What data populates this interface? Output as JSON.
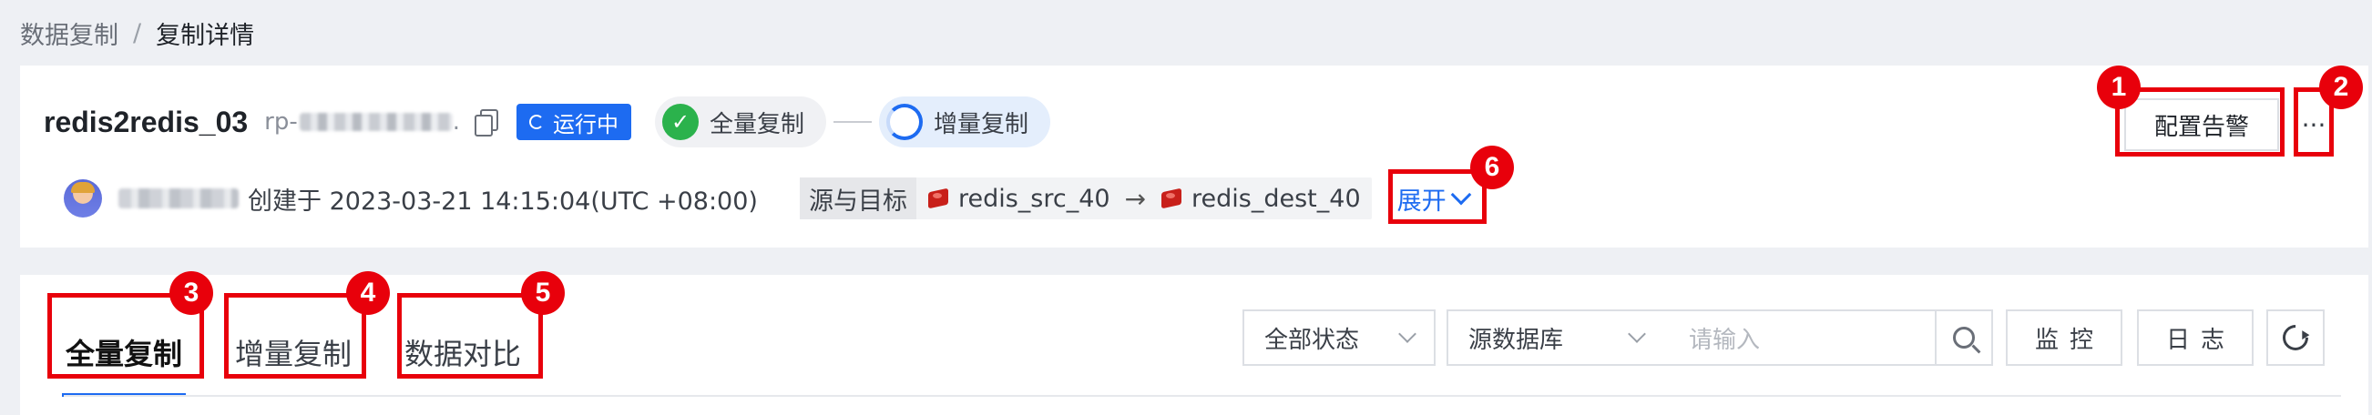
{
  "breadcrumb": {
    "parent": "数据复制",
    "separator": "/",
    "current": "复制详情"
  },
  "task": {
    "name": "redis2redis_03",
    "id_prefix": "rp-",
    "id_suffix": ".",
    "status": "运行中",
    "steps": [
      {
        "label": "全量复制",
        "state": "done"
      },
      {
        "label": "增量复制",
        "state": "running"
      }
    ]
  },
  "meta": {
    "created_text": "创建于 2023-03-21 14:15:04(UTC +08:00)",
    "route_label": "源与目标",
    "source": "redis_src_40",
    "arrow": "→",
    "target": "redis_dest_40",
    "expand_label": "展开"
  },
  "actions": {
    "alert_button": "配置告警",
    "more_button": "···"
  },
  "tabs": [
    {
      "label": "全量复制",
      "active": true
    },
    {
      "label": "增量复制",
      "active": false
    },
    {
      "label": "数据对比",
      "active": false
    }
  ],
  "filters": {
    "status_select": "全部状态",
    "db_select": "源数据库",
    "search_placeholder": "请输入",
    "monitor_button": "监控",
    "log_button": "日志"
  },
  "annotations": [
    "1",
    "2",
    "3",
    "4",
    "5",
    "6"
  ],
  "colors": {
    "primary": "#1d6bf1",
    "success": "#2bb24c",
    "highlight": "#e8000b",
    "redis": "#c8201a"
  },
  "icons": [
    "copy-icon",
    "spinner-icon",
    "check-icon",
    "redis-icon",
    "chevron-down-icon",
    "search-icon",
    "refresh-icon"
  ]
}
